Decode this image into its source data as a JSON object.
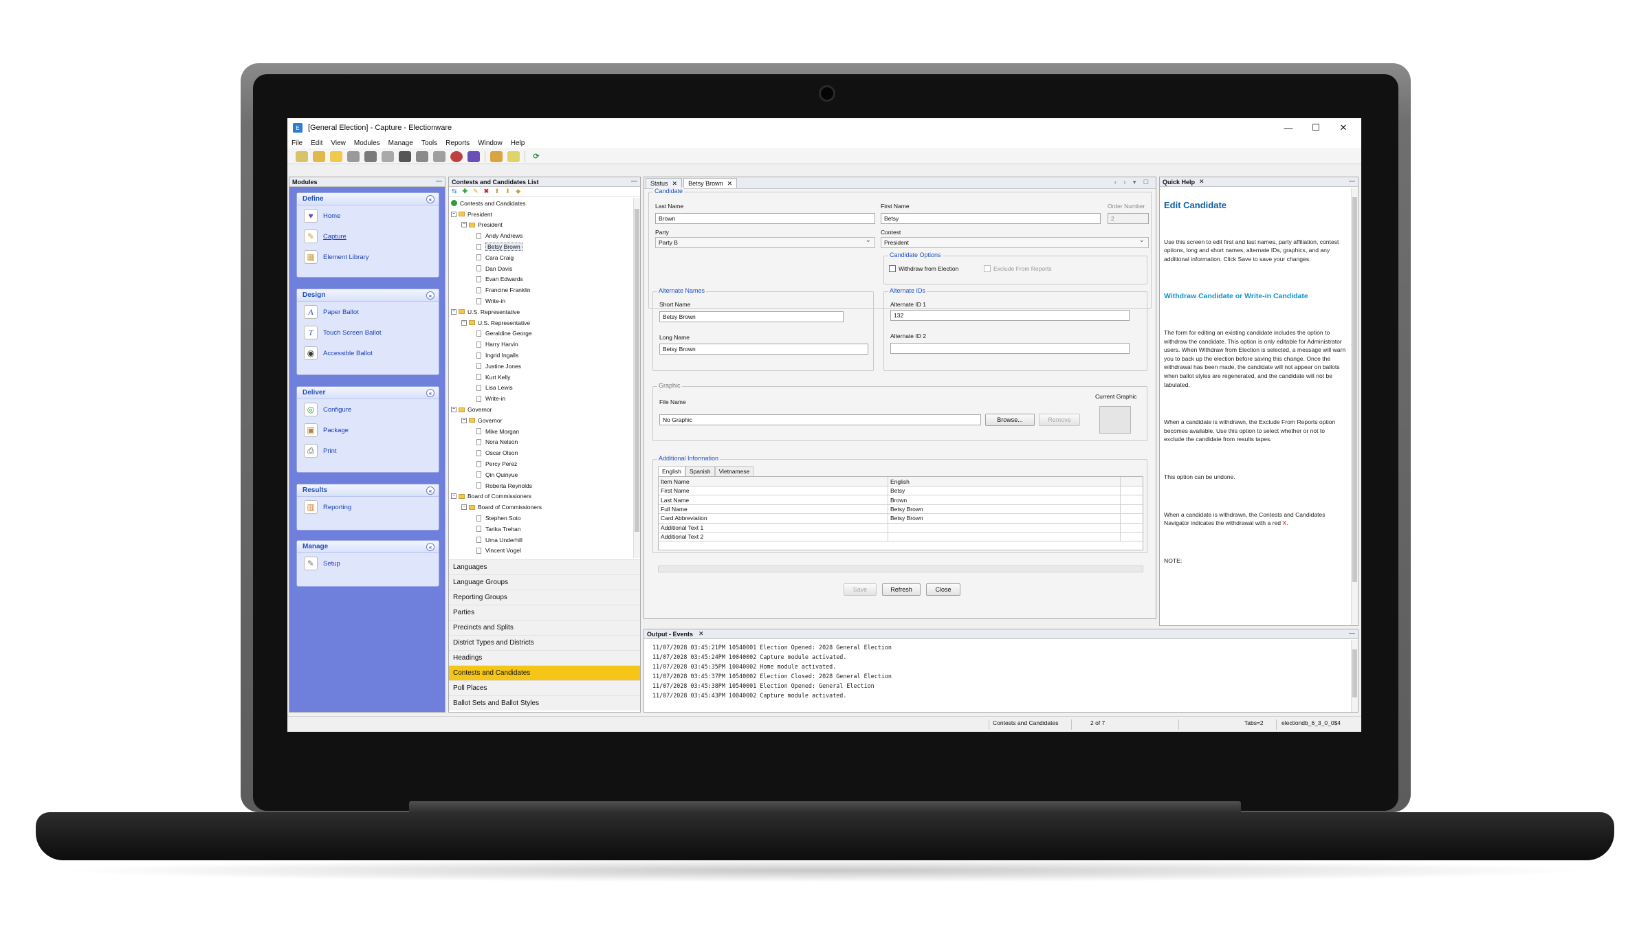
{
  "window": {
    "title": "[General Election] - Capture - Electionware",
    "controls": [
      "—",
      "☐",
      "✕"
    ]
  },
  "menu": [
    "File",
    "Edit",
    "View",
    "Modules",
    "Manage",
    "Tools",
    "Reports",
    "Window",
    "Help"
  ],
  "modules_panel": {
    "title": "Modules",
    "groups": [
      {
        "title": "Define",
        "items": [
          {
            "label": "Home",
            "icon": "heart-shield-icon"
          },
          {
            "label": "Capture",
            "icon": "capture-icon"
          },
          {
            "label": "Element Library",
            "icon": "library-icon"
          }
        ]
      },
      {
        "title": "Design",
        "items": [
          {
            "label": "Paper Ballot",
            "icon": "paper-ballot-icon"
          },
          {
            "label": "Touch Screen Ballot",
            "icon": "touch-screen-icon"
          },
          {
            "label": "Accessible Ballot",
            "icon": "accessible-icon"
          }
        ]
      },
      {
        "title": "Deliver",
        "items": [
          {
            "label": "Configure",
            "icon": "configure-icon"
          },
          {
            "label": "Package",
            "icon": "package-icon"
          },
          {
            "label": "Print",
            "icon": "print-icon"
          }
        ]
      },
      {
        "title": "Results",
        "items": [
          {
            "label": "Reporting",
            "icon": "chart-icon"
          }
        ]
      },
      {
        "title": "Manage",
        "items": [
          {
            "label": "Setup",
            "icon": "wrench-icon"
          }
        ]
      }
    ]
  },
  "contests_panel": {
    "title": "Contests and Candidates List",
    "root": "Contests and Candidates",
    "contests": [
      {
        "name": "President",
        "office": "President",
        "candidates": [
          "Andy Andrews",
          "Betsy Brown",
          "Cara Craig",
          "Dan Davis",
          "Evan Edwards",
          "Francine Franklin",
          "Write-in"
        ]
      },
      {
        "name": "U.S. Representative",
        "office": "U.S. Representative",
        "candidates": [
          "Geraldine George",
          "Harry Harvin",
          "Ingrid Ingalls",
          "Justine Jones",
          "Kurt Kelly",
          "Lisa Lewis",
          "Write-in"
        ]
      },
      {
        "name": "Governor",
        "office": "Governor",
        "candidates": [
          "Mike Morgan",
          "Nora Nelson",
          "Oscar Olson",
          "Percy Perez",
          "Qin Quinyue",
          "Roberta Reynolds"
        ]
      },
      {
        "name": "Board of Commissioners",
        "office": "Board of Commissioners",
        "candidates": [
          "Stephen Soto",
          "Tarika Trehan",
          "Uma Underhill",
          "Vincent Vogel"
        ]
      }
    ],
    "nav": [
      "Languages",
      "Language Groups",
      "Reporting Groups",
      "Parties",
      "Precincts and Splits",
      "District Types and Districts",
      "Headings",
      "Contests and Candidates",
      "Poll Places",
      "Ballot Sets and Ballot Styles"
    ],
    "active_nav": "Contests and Candidates"
  },
  "editor": {
    "tabs": [
      "Status",
      "Betsy Brown"
    ],
    "candidate_group": "Candidate",
    "last_name_label": "Last Name",
    "last_name": "Brown",
    "first_name_label": "First Name",
    "first_name": "Betsy",
    "order_number_label": "Order Number",
    "order_number": "2",
    "party_label": "Party",
    "party": "Party B",
    "contest_label": "Contest",
    "contest": "President",
    "candidate_options_group": "Candidate Options",
    "withdraw_label": "Withdraw from Election",
    "exclude_label": "Exclude From Reports",
    "alt_names_group": "Alternate Names",
    "short_name_label": "Short Name",
    "short_name": "Betsy Brown",
    "long_name_label": "Long Name",
    "long_name": "Betsy Brown",
    "alt_ids_group": "Alternate IDs",
    "alt_id1_label": "Alternate ID 1",
    "alt_id1": "132",
    "alt_id2_label": "Alternate ID 2",
    "alt_id2": "",
    "graphic_group": "Graphic",
    "file_name_label": "File Name",
    "file_name": "No Graphic",
    "browse_label": "Browse...",
    "remove_label": "Remove",
    "current_graphic_label": "Current Graphic",
    "additional_group": "Additional Information",
    "lang_tabs": [
      "English",
      "Spanish",
      "Vietnamese"
    ],
    "grid_headers": [
      "Item Name",
      "English"
    ],
    "grid_rows": [
      [
        "First Name",
        "Betsy"
      ],
      [
        "Last Name",
        "Brown"
      ],
      [
        "Full Name",
        "Betsy Brown"
      ],
      [
        "Card Abbreviation",
        "Betsy Brown"
      ],
      [
        "Additional Text 1",
        ""
      ],
      [
        "Additional Text 2",
        ""
      ]
    ],
    "save_label": "Save",
    "refresh_label": "Refresh",
    "close_label": "Close"
  },
  "quick_help": {
    "title": "Quick Help",
    "heading": "Edit Candidate",
    "p1": "Use this screen to edit first and last names, party affiliation, contest options, long and short names, alternate IDs, graphics, and any additional information. Click Save to save your changes.",
    "subheading": "Withdraw Candidate or Write-in Candidate",
    "p2": "The form for editing an existing candidate includes the option to withdraw the candidate. This option is only editable for Administrator users. When Withdraw from Election is selected, a message will warn you to back up the election before saving this change. Once the withdrawal has been made, the candidate will not appear on ballots when ballot styles are regenerated, and the candidate will not be tabulated.",
    "p3": "When a candidate is withdrawn, the Exclude From Reports option becomes available. Use this option to select whether or not to exclude the candidate from results tapes.",
    "p4": "This option can be undone.",
    "p5_text": "When a candidate is withdrawn, the Contests and Candidates Navigator indicates the withdrawal with a red",
    "p5_red": "X",
    "p5_end": ".",
    "note": "NOTE:"
  },
  "output": {
    "title": "Output - Events",
    "lines": [
      "11/07/2028 03:45:21PM 10540001 Election Opened: 2028 General Election",
      "11/07/2028 03:45:24PM 10040002 Capture module activated.",
      "11/07/2028 03:45:35PM 10040002 Home module activated.",
      "11/07/2028 03:45:37PM 10540002 Election Closed: 2028 General Election",
      "11/07/2028 03:45:38PM 10540001 Election Opened: General Election",
      "11/07/2028 03:45:43PM 10040002 Capture module activated."
    ]
  },
  "status_bar": {
    "section": "Contests and Candidates",
    "position": "2 of 7",
    "tabs": "Tabs=2",
    "database": "electiondb_6_3_0_0$4"
  },
  "colors": {
    "modules_bg": "#6f7fdc",
    "active_nav": "#f5c518",
    "help_heading": "#0d5fa8",
    "help_subheading": "#0f95c9"
  }
}
